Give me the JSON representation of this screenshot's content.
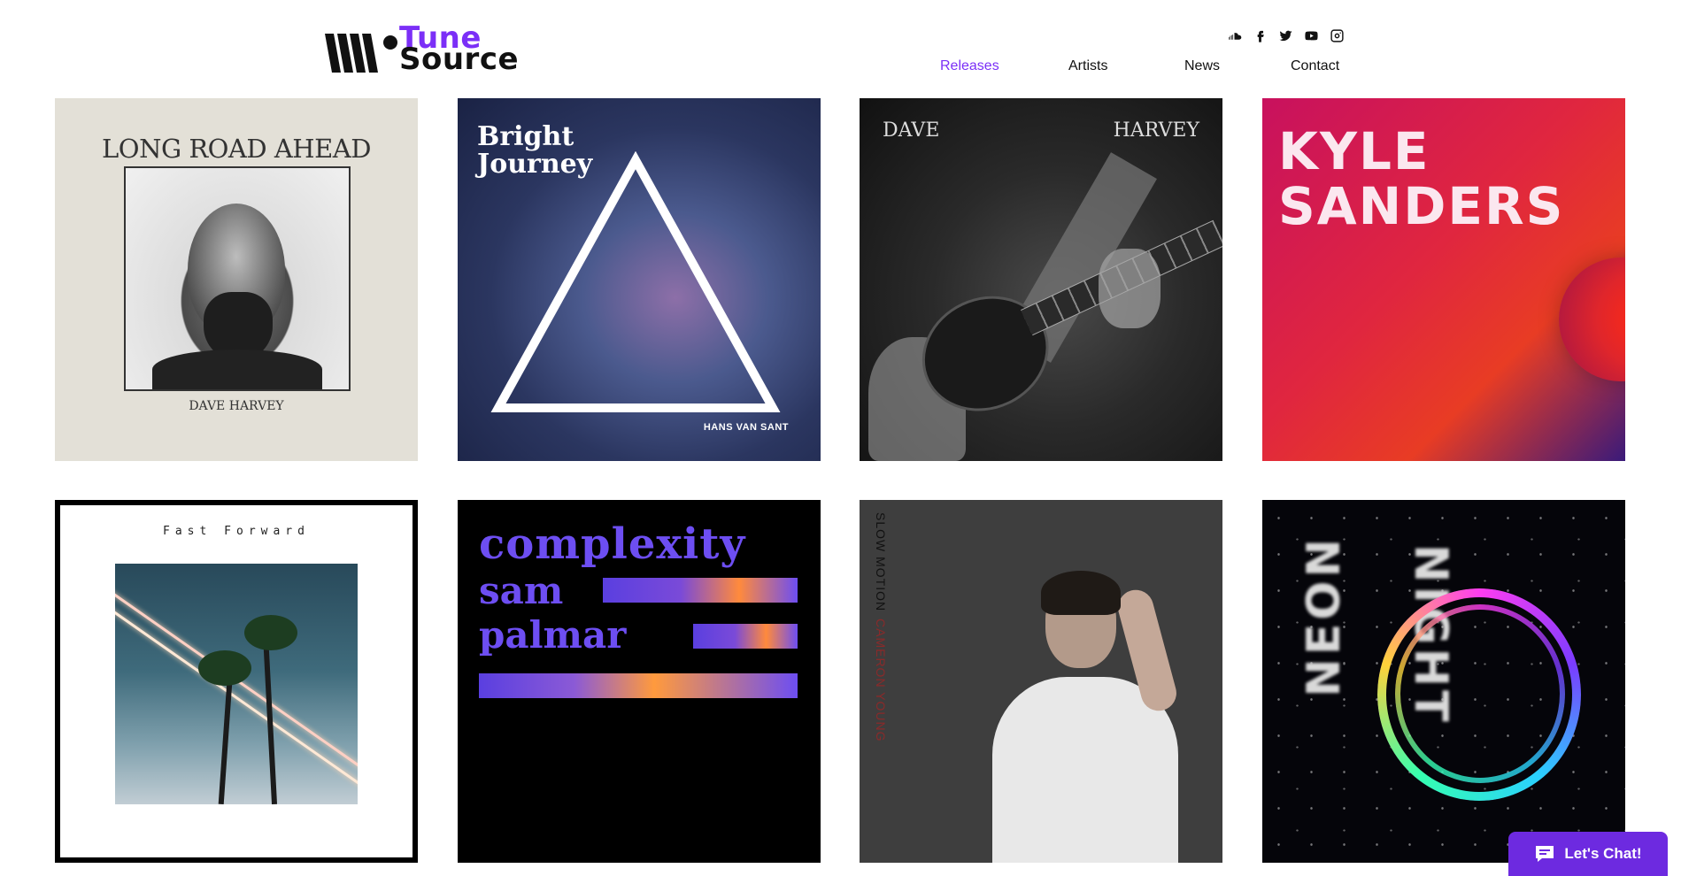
{
  "brand": {
    "word1": "Tune",
    "word2": "Source"
  },
  "nav": [
    {
      "label": "Releases",
      "active": true
    },
    {
      "label": "Artists",
      "active": false
    },
    {
      "label": "News",
      "active": false
    },
    {
      "label": "Contact",
      "active": false
    }
  ],
  "social": [
    "soundcloud-icon",
    "facebook-icon",
    "twitter-icon",
    "youtube-icon",
    "instagram-icon"
  ],
  "colors": {
    "accent": "#7b2ff7",
    "chat_bg": "#6d2ae0",
    "text": "#111111"
  },
  "releases": [
    {
      "title": "LONG ROAD AHEAD",
      "artist": "DAVE HARVEY"
    },
    {
      "title": "Bright Journey",
      "artist": "HANS VAN SANT"
    },
    {
      "title_left": "DAVE",
      "title_right": "HARVEY"
    },
    {
      "line1": "KYLE",
      "line2": "SANDERS"
    },
    {
      "title": "Fast Forward"
    },
    {
      "line1": "complexity",
      "line2": "sam",
      "line3": "palmar"
    },
    {
      "title": "SLOW MOTION",
      "artist": "CAMERON YOUNG"
    },
    {
      "line1": "NEON",
      "line2": "NIGHT"
    }
  ],
  "chat": {
    "label": "Let's Chat!"
  }
}
